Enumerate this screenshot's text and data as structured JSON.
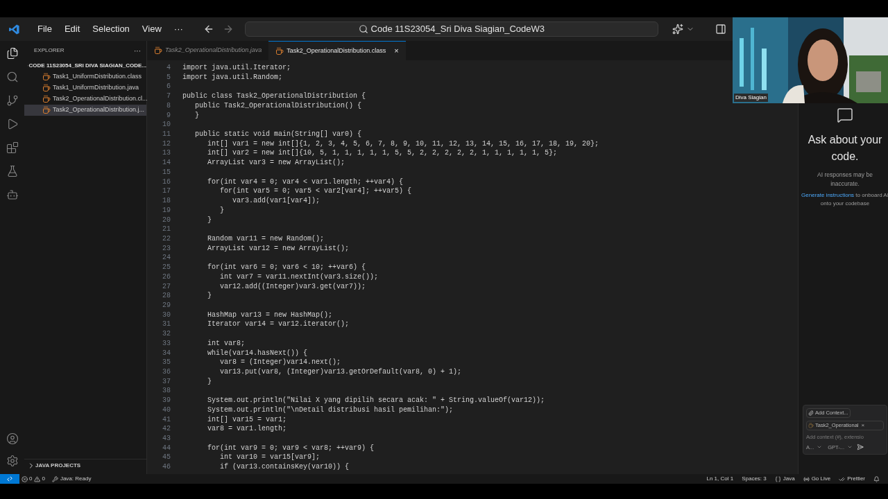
{
  "menu": [
    "File",
    "Edit",
    "Selection",
    "View",
    "···"
  ],
  "command_center": {
    "value": "Code 11S23054_Sri Diva Siagian_CodeW3"
  },
  "activity_bar": [
    {
      "kind": "files",
      "selected": true
    },
    {
      "kind": "search",
      "selected": false
    },
    {
      "kind": "git",
      "selected": false
    },
    {
      "kind": "run",
      "selected": false
    },
    {
      "kind": "extensions",
      "selected": false
    },
    {
      "kind": "test",
      "selected": false
    },
    {
      "kind": "remote",
      "selected": false
    }
  ],
  "sidebar": {
    "title": "EXPLORER",
    "more": "···",
    "folder": "CODE 11S23054_SRI DIVA SIAGIAN_CODE...",
    "items": [
      {
        "label": "Task1_UniformDistribution.class",
        "selected": false
      },
      {
        "label": "Task1_UniformDistribution.java",
        "selected": false
      },
      {
        "label": "Task2_OperationalDistribution.cl...",
        "selected": false
      },
      {
        "label": "Task2_OperationalDistribution.j...",
        "selected": true
      }
    ],
    "section": "JAVA PROJECTS"
  },
  "tabs": [
    {
      "label": "Task2_OperationalDistribution.java",
      "selected": false
    },
    {
      "label": "Task2_OperationalDistribution.class",
      "selected": true,
      "close": "×"
    }
  ],
  "editor": {
    "lines": [
      {
        "n": "4",
        "code": "import java.util.Iterator;"
      },
      {
        "n": "5",
        "code": "import java.util.Random;"
      },
      {
        "n": "6"
      },
      {
        "n": "7",
        "code": "public class Task2_OperationalDistribution {"
      },
      {
        "n": "8",
        "code": "   public Task2_OperationalDistribution() {"
      },
      {
        "n": "9",
        "code": "   }"
      },
      {
        "n": "10"
      },
      {
        "n": "11",
        "code": "   public static void main(String[] var0) {"
      },
      {
        "n": "12",
        "code": "      int[] var1 = new int[]{1, 2, 3, 4, 5, 6, 7, 8, 9, 10, 11, 12, 13, 14, 15, 16, 17, 18, 19, 20};"
      },
      {
        "n": "13",
        "code": "      int[] var2 = new int[]{10, 5, 1, 1, 1, 1, 1, 5, 5, 2, 2, 2, 2, 2, 1, 1, 1, 1, 1, 5};"
      },
      {
        "n": "14",
        "code": "      ArrayList var3 = new ArrayList();"
      },
      {
        "n": "15"
      },
      {
        "n": "16",
        "code": "      for(int var4 = 0; var4 < var1.length; ++var4) {"
      },
      {
        "n": "17",
        "code": "         for(int var5 = 0; var5 < var2[var4]; ++var5) {"
      },
      {
        "n": "18",
        "code": "            var3.add(var1[var4]);"
      },
      {
        "n": "19",
        "code": "         }"
      },
      {
        "n": "20",
        "code": "      }"
      },
      {
        "n": "21"
      },
      {
        "n": "22",
        "code": "      Random var11 = new Random();"
      },
      {
        "n": "23",
        "code": "      ArrayList var12 = new ArrayList();"
      },
      {
        "n": "24"
      },
      {
        "n": "25",
        "code": "      for(int var6 = 0; var6 < 10; ++var6) {"
      },
      {
        "n": "26",
        "code": "         int var7 = var11.nextInt(var3.size());"
      },
      {
        "n": "27",
        "code": "         var12.add((Integer)var3.get(var7));"
      },
      {
        "n": "28",
        "code": "      }"
      },
      {
        "n": "29"
      },
      {
        "n": "30",
        "code": "      HashMap var13 = new HashMap();"
      },
      {
        "n": "31",
        "code": "      Iterator var14 = var12.iterator();"
      },
      {
        "n": "32"
      },
      {
        "n": "33",
        "code": "      int var8;"
      },
      {
        "n": "34",
        "code": "      while(var14.hasNext()) {"
      },
      {
        "n": "35",
        "code": "         var8 = (Integer)var14.next();"
      },
      {
        "n": "36",
        "code": "         var13.put(var8, (Integer)var13.getOrDefault(var8, 0) + 1);"
      },
      {
        "n": "37",
        "code": "      }"
      },
      {
        "n": "38"
      },
      {
        "n": "39",
        "code": "      System.out.println(\"Nilai X yang dipilih secara acak: \" + String.valueOf(var12));"
      },
      {
        "n": "40",
        "code": "      System.out.println(\"\\nDetail distribusi hasil pemilihan:\");"
      },
      {
        "n": "41",
        "code": "      int[] var15 = var1;"
      },
      {
        "n": "42",
        "code": "      var8 = var1.length;"
      },
      {
        "n": "43"
      },
      {
        "n": "44",
        "code": "      for(int var9 = 0; var9 < var8; ++var9) {"
      },
      {
        "n": "45",
        "code": "         int var10 = var15[var9];"
      },
      {
        "n": "46",
        "code": "         if (var13.containsKey(var10)) {"
      }
    ]
  },
  "video": {
    "kind": "picture",
    "name": "Diva Siagian"
  },
  "chat": {
    "heading": "Ask about your code.",
    "note": "AI responses may be inaccurate.",
    "link": "Generate instructions",
    "link_rest": " to onboard AI onto your codebase",
    "add_context": "Add Context...",
    "chip": "Task2_Operational",
    "chip_close": "×",
    "placeholder": "Add context (#), extensio",
    "mode": "A...",
    "model": "GPT-..."
  },
  "status_bar": {
    "errors": "0",
    "warnings": "0",
    "java": "Java: Ready",
    "right": [
      {
        "kind": "text",
        "label": "Ln 1, Col 1"
      },
      {
        "kind": "text",
        "label": "Spaces: 3"
      },
      {
        "kind": "lang",
        "label": "Java"
      },
      {
        "kind": "golive",
        "label": "Go Live"
      },
      {
        "kind": "prettier",
        "label": "Prettier"
      },
      {
        "kind": "bell"
      }
    ]
  }
}
